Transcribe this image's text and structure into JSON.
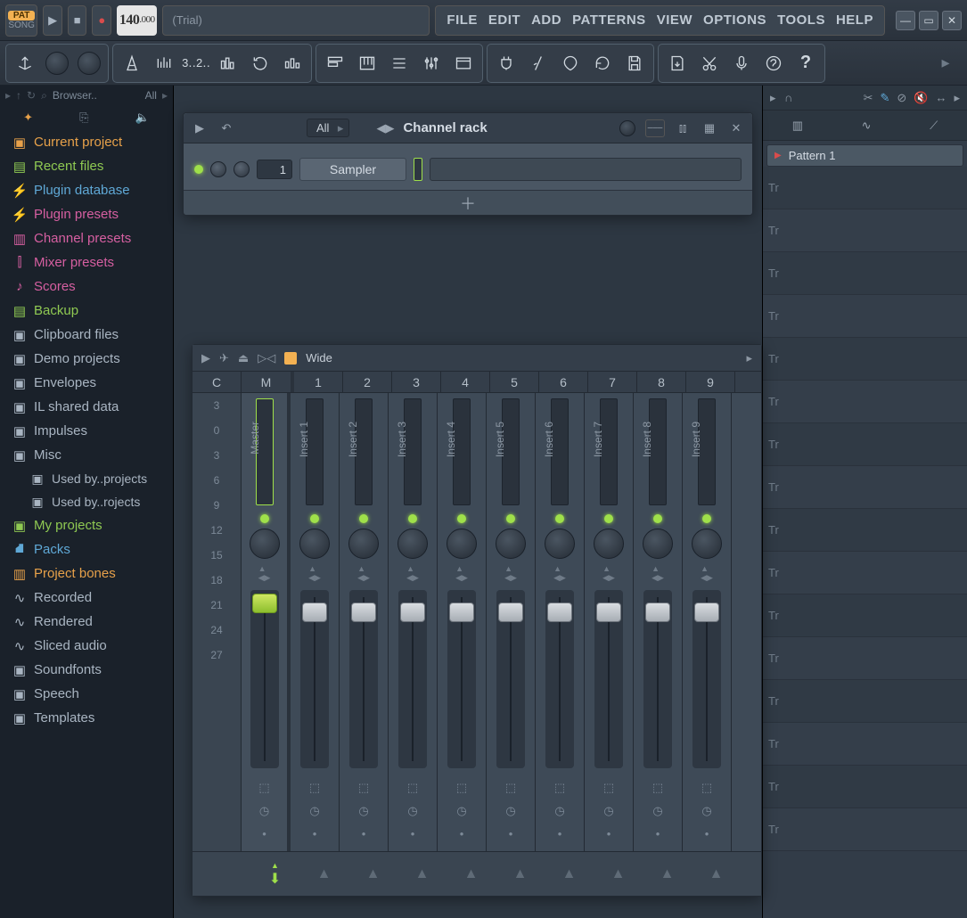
{
  "titlebar": {
    "pat": "PAT",
    "song": "SONG",
    "tempo_int": "140",
    "tempo_frac": ".000",
    "lcd": "(Trial)",
    "menus": [
      "FILE",
      "EDIT",
      "ADD",
      "PATTERNS",
      "VIEW",
      "OPTIONS",
      "TOOLS",
      "HELP"
    ]
  },
  "browser": {
    "header": "Browser..",
    "filter": "All",
    "items": [
      {
        "label": "Current project",
        "color": "#e7a14a",
        "icon": "folder"
      },
      {
        "label": "Recent files",
        "color": "#8fc952",
        "icon": "folder-open"
      },
      {
        "label": "Plugin database",
        "color": "#5fa8d6",
        "icon": "plug"
      },
      {
        "label": "Plugin presets",
        "color": "#d65fa1",
        "icon": "plug"
      },
      {
        "label": "Channel presets",
        "color": "#d65fa1",
        "icon": "bars"
      },
      {
        "label": "Mixer presets",
        "color": "#d65fa1",
        "icon": "sliders"
      },
      {
        "label": "Scores",
        "color": "#d65fa1",
        "icon": "note"
      },
      {
        "label": "Backup",
        "color": "#8fc952",
        "icon": "folder-open"
      },
      {
        "label": "Clipboard files",
        "color": "#a9b5c2",
        "icon": "folder"
      },
      {
        "label": "Demo projects",
        "color": "#a9b5c2",
        "icon": "folder"
      },
      {
        "label": "Envelopes",
        "color": "#a9b5c2",
        "icon": "folder"
      },
      {
        "label": "IL shared data",
        "color": "#a9b5c2",
        "icon": "folder"
      },
      {
        "label": "Impulses",
        "color": "#a9b5c2",
        "icon": "folder"
      },
      {
        "label": "Misc",
        "color": "#a9b5c2",
        "icon": "folder",
        "expanded": true
      },
      {
        "label": "Used by..projects",
        "color": "#a9b5c2",
        "icon": "folder",
        "sub": true
      },
      {
        "label": "Used by..rojects",
        "color": "#a9b5c2",
        "icon": "folder",
        "sub": true
      },
      {
        "label": "My projects",
        "color": "#8fc952",
        "icon": "folder"
      },
      {
        "label": "Packs",
        "color": "#5fa8d6",
        "icon": "archive"
      },
      {
        "label": "Project bones",
        "color": "#e7a14a",
        "icon": "bars"
      },
      {
        "label": "Recorded",
        "color": "#a9b5c2",
        "icon": "wave"
      },
      {
        "label": "Rendered",
        "color": "#a9b5c2",
        "icon": "wave"
      },
      {
        "label": "Sliced audio",
        "color": "#a9b5c2",
        "icon": "wave"
      },
      {
        "label": "Soundfonts",
        "color": "#a9b5c2",
        "icon": "folder"
      },
      {
        "label": "Speech",
        "color": "#a9b5c2",
        "icon": "folder"
      },
      {
        "label": "Templates",
        "color": "#a9b5c2",
        "icon": "folder"
      }
    ]
  },
  "rack": {
    "filter": "All",
    "title": "Channel rack",
    "channel_num": "1",
    "channel_name": "Sampler"
  },
  "mixer": {
    "layout": "Wide",
    "headers": [
      "C",
      "M",
      "1",
      "2",
      "3",
      "4",
      "5",
      "6",
      "7",
      "8",
      "9"
    ],
    "master": "Master",
    "inserts": [
      "Insert 1",
      "Insert 2",
      "Insert 3",
      "Insert 4",
      "Insert 5",
      "Insert 6",
      "Insert 7",
      "Insert 8",
      "Insert 9"
    ],
    "db": [
      "3",
      "0",
      "3",
      "6",
      "9",
      "12",
      "15",
      "18",
      "21",
      "24",
      "27"
    ]
  },
  "playlist": {
    "pattern": "Pattern 1",
    "tracks": [
      "Tr",
      "Tr",
      "Tr",
      "Tr",
      "Tr",
      "Tr",
      "Tr",
      "Tr",
      "Tr",
      "Tr",
      "Tr",
      "Tr",
      "Tr",
      "Tr",
      "Tr",
      "Tr"
    ]
  }
}
